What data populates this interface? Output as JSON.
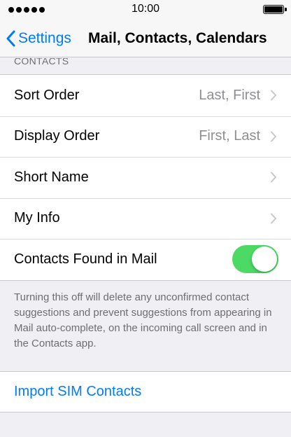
{
  "status_bar": {
    "time": "10:00"
  },
  "nav": {
    "back_label": "Settings",
    "title": "Mail, Contacts, Calendars"
  },
  "section": {
    "header": "CONTACTS"
  },
  "rows": [
    {
      "label": "Sort Order",
      "value": "Last, First"
    },
    {
      "label": "Display Order",
      "value": "First, Last"
    },
    {
      "label": "Short Name",
      "value": ""
    },
    {
      "label": "My Info",
      "value": ""
    }
  ],
  "toggle_row": {
    "label": "Contacts Found in Mail",
    "on": true
  },
  "footer_note": "Turning this off will delete any unconfirmed contact suggestions and prevent suggestions from appearing in Mail auto-complete, on the incoming call screen and in the Contacts app.",
  "import": {
    "label": "Import SIM Contacts"
  },
  "colors": {
    "accent": "#007aff",
    "toggle_on": "#4cd964",
    "background": "#efeff4",
    "secondary_text": "#8e8e93"
  },
  "icons": [
    "back-chevron-icon",
    "disclosure-chevron-icon",
    "signal-dots-icon",
    "battery-icon"
  ]
}
